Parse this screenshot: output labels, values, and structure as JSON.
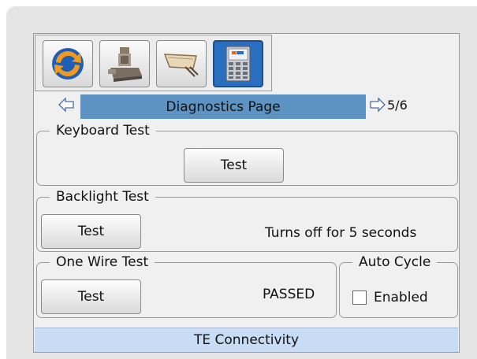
{
  "toolbar": {
    "buttons": [
      {
        "icon": "sync-icon"
      },
      {
        "icon": "machine-icon"
      },
      {
        "icon": "cable-icon"
      },
      {
        "icon": "device-keypad-icon",
        "selected": true
      }
    ]
  },
  "nav": {
    "title": "Diagnostics Page",
    "page": "5/6"
  },
  "keyboard_test": {
    "legend": "Keyboard Test",
    "button": "Test"
  },
  "backlight_test": {
    "legend": "Backlight Test",
    "button": "Test",
    "info": "Turns off for  5 seconds"
  },
  "one_wire_test": {
    "legend": "One Wire Test",
    "button": "Test",
    "status": "PASSED"
  },
  "auto_cycle": {
    "legend": "Auto Cycle",
    "checkbox_label": "Enabled",
    "checked": false
  },
  "footer": {
    "text": "TE Connectivity"
  },
  "colors": {
    "title_bar": "#5d93c2",
    "footer": "#c8dcf5",
    "selected_tool": "#2a6fbf"
  }
}
